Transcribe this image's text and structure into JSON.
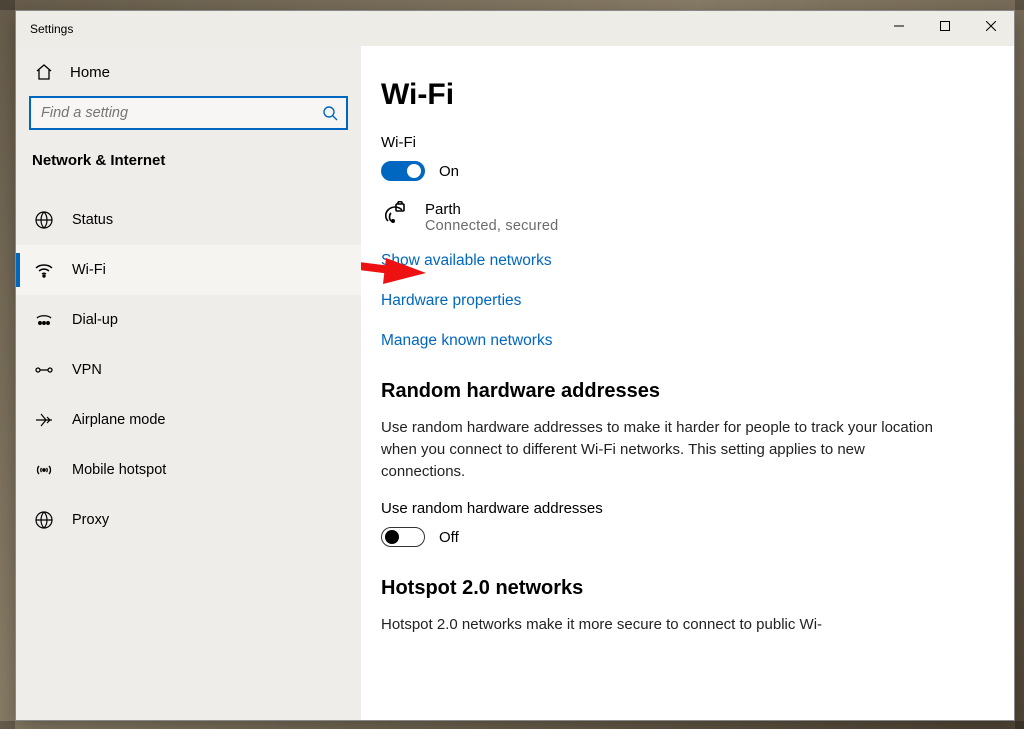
{
  "titlebar": {
    "title": "Settings"
  },
  "sidebar": {
    "home_label": "Home",
    "search_placeholder": "Find a setting",
    "section_label": "Network & Internet",
    "items": [
      {
        "id": "status",
        "label": "Status"
      },
      {
        "id": "wifi",
        "label": "Wi-Fi"
      },
      {
        "id": "dialup",
        "label": "Dial-up"
      },
      {
        "id": "vpn",
        "label": "VPN"
      },
      {
        "id": "airplane-mode",
        "label": "Airplane mode"
      },
      {
        "id": "mobile-hotspot",
        "label": "Mobile hotspot"
      },
      {
        "id": "proxy",
        "label": "Proxy"
      }
    ],
    "active_id": "wifi"
  },
  "content": {
    "page_title": "Wi-Fi",
    "wifi_switch": {
      "label": "Wi-Fi",
      "state_label": "On",
      "on": true
    },
    "current_network": {
      "name": "Parth",
      "status": "Connected, secured"
    },
    "links": {
      "show_available": "Show available networks",
      "hardware_props": "Hardware properties",
      "manage_known": "Manage known networks"
    },
    "random_hw": {
      "title": "Random hardware addresses",
      "description": "Use random hardware addresses to make it harder for people to track your location when you connect to different Wi-Fi networks. This setting applies to new connections.",
      "toggle_label": "Use random hardware addresses",
      "state_label": "Off",
      "on": false
    },
    "hotspot2": {
      "title": "Hotspot 2.0 networks",
      "description": "Hotspot 2.0 networks make it more secure to connect to public Wi-"
    }
  },
  "colors": {
    "accent": "#0067c0"
  }
}
